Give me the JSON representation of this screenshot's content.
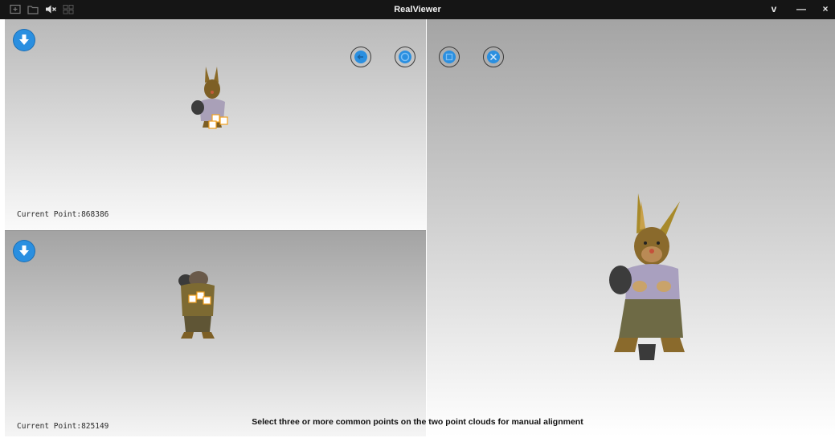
{
  "app": {
    "title": "RealViewer"
  },
  "titlebar": {
    "left_icons": [
      "new-project-icon",
      "open-folder-icon",
      "sound-muted-icon",
      "layout-icon"
    ],
    "controls": {
      "menu": "v",
      "minimize": "—",
      "close": "×"
    }
  },
  "viewports": {
    "top_left": {
      "point_label": "Current Point:868386"
    },
    "bottom_left": {
      "point_label": "Current Point:825149"
    }
  },
  "toolbar": {
    "tools": [
      "arrow-left-icon",
      "confirm-icon",
      "apply-icon",
      "cancel-icon"
    ]
  },
  "status": {
    "message": "Select three or more common points on the two point clouds for manual alignment"
  },
  "colors": {
    "titlebar": "#151515",
    "accent_blue": "#2a8fe0",
    "marker_orange": "#f0a020"
  }
}
